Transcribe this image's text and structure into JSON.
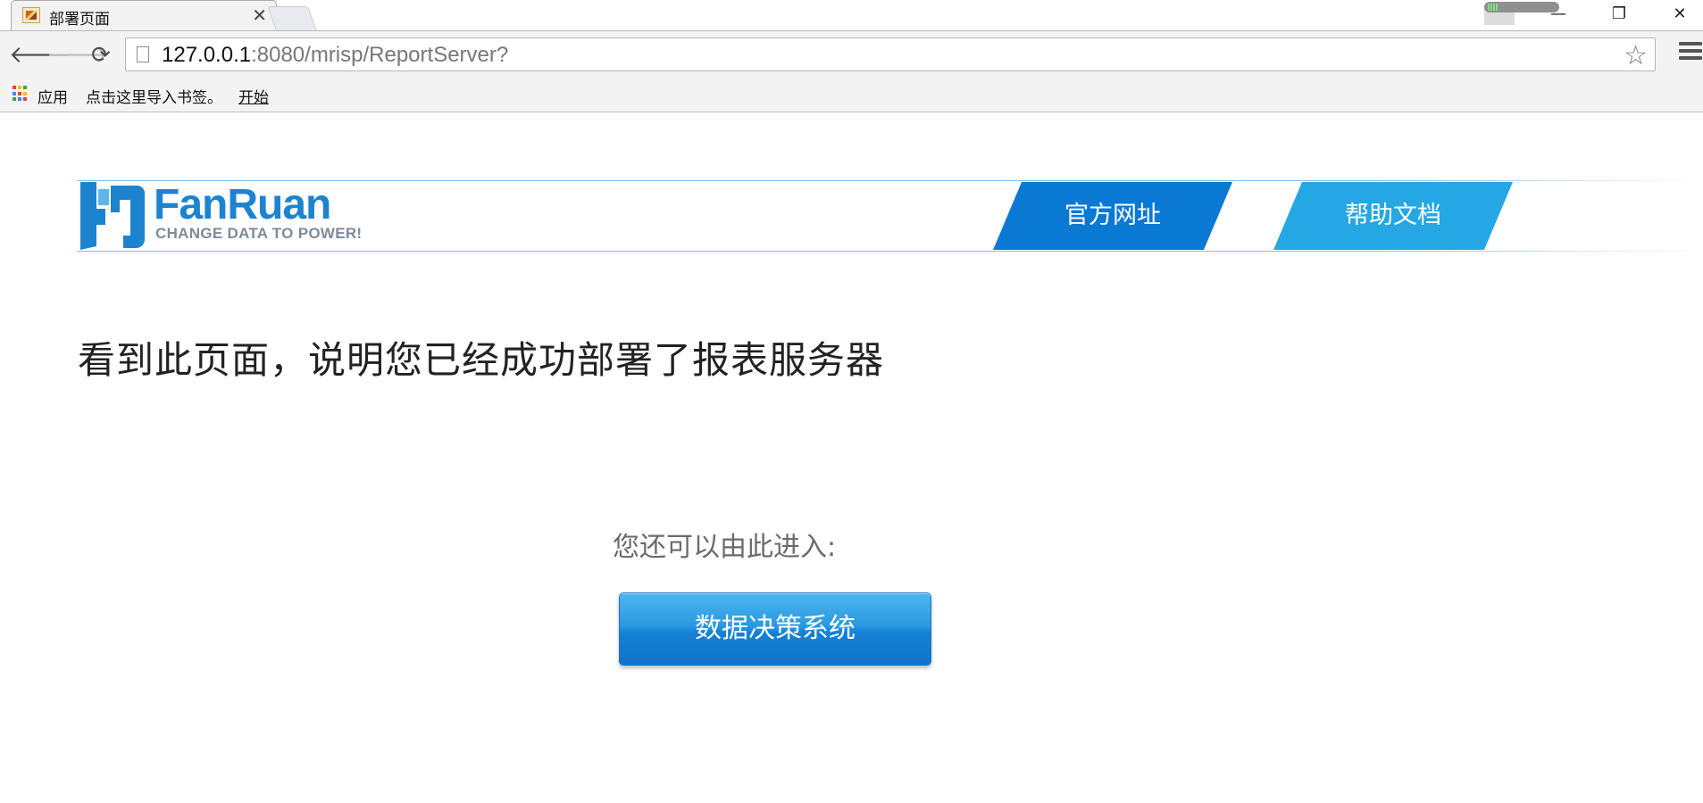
{
  "browser": {
    "tab_title": "部署页面",
    "tab_close": "✕",
    "url_host": "127.0.0.1",
    "url_rest": ":8080/mrisp/ReportServer?",
    "window_controls": {
      "minimize": "—",
      "restore": "❐",
      "close": "✕"
    },
    "nav": {
      "back": "🡐",
      "forward": "🡒",
      "reload": "⟳"
    },
    "star": "☆",
    "bookmarks": {
      "apps": "应用",
      "import": "点击这里导入书签。",
      "start": "开始"
    }
  },
  "brand": {
    "name": "FanRuan",
    "tagline": "CHANGE DATA TO POWER!",
    "color": "#1e83cf"
  },
  "nav_links": [
    {
      "label": "官方网址",
      "color": "#0a79d4"
    },
    {
      "label": "帮助文档",
      "color": "#24a7e4"
    }
  ],
  "main": {
    "headline": "看到此页面，说明您已经成功部署了报表服务器",
    "enter_label": "您还可以由此进入:",
    "button_label": "数据决策系统"
  }
}
